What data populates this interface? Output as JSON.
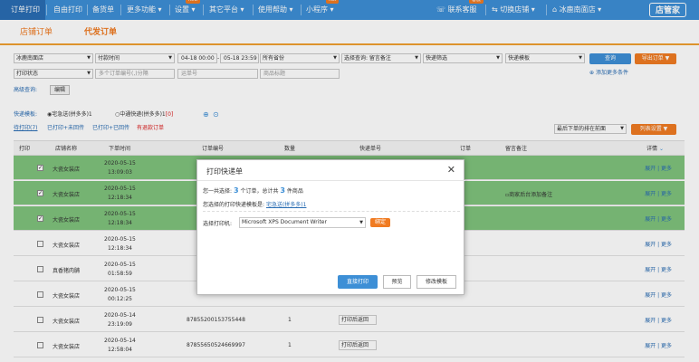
{
  "nav": {
    "items": [
      "订单打印",
      "自由打印",
      "备货单",
      "更多功能",
      "设置",
      "其它平台",
      "使用帮助",
      "小程序"
    ],
    "settings_badge": "new",
    "miniapp_badge": "hot",
    "right_items": [
      "联系客服",
      "切换店铺",
      "冰鹿南面店"
    ],
    "right_badge": "客服",
    "brand": "店管家"
  },
  "subtabs": [
    "店铺订单",
    "代发订单"
  ],
  "filters": {
    "row1": {
      "store": "冰鹿南面店",
      "time_type": "付款时间",
      "date_start": "04-18 00:00",
      "date_end": "05-18 23:59",
      "province": "所有省份",
      "note_query": "选择查询: 留言备注",
      "express_filter": "快递筛选",
      "express_template": "快递模板",
      "query_btn": "查询",
      "export_btn": "导出订单 ▼"
    },
    "row2": {
      "print_status": "打印状态",
      "order_no_placeholder": "多个订单编号(,)分隔",
      "waybill_placeholder": "运单号",
      "product_placeholder": "商品标题",
      "add_condition": "添加更多条件"
    },
    "row3": {
      "label": "高级查询:",
      "edit_btn": "编辑"
    }
  },
  "express": {
    "label": "快递模板:",
    "opt1": "宅急送(拼多多)1",
    "opt2": "中通快递(拼多多)1",
    "opt2_count": "[0]",
    "add_icon": "plus-circle-icon",
    "settings_icon": "gear-circle-icon"
  },
  "status_links": {
    "l1": "待打印",
    "l1_count": "(7)",
    "l2": "已打印+未回传",
    "l3": "已打印+已回传",
    "l4": "有退款订单",
    "sort": "最后下单的排在前面",
    "list_settings": "列表设置 ▼"
  },
  "table": {
    "headers": [
      "打印",
      "店铺名称",
      "下单时间",
      "订单编号",
      "数量",
      "快递单号",
      "订单",
      "留言备注",
      "详情"
    ],
    "rows": [
      {
        "checked": true,
        "hl": true,
        "store": "大瓷女装店",
        "date": "2020-05-15",
        "time": "13:09:03",
        "order": "",
        "qty": "",
        "ship": "",
        "remark": "",
        "actions": "展开 | 更多"
      },
      {
        "checked": true,
        "hl": true,
        "store": "大瓷女装店",
        "date": "2020-05-15",
        "time": "12:18:34",
        "order": "",
        "qty": "",
        "ship": "",
        "remark": "商家后台添加备注",
        "actions": "展开 | 更多"
      },
      {
        "checked": true,
        "hl": true,
        "store": "大瓷女装店",
        "date": "2020-05-15",
        "time": "12:18:34",
        "order": "",
        "qty": "",
        "ship": "",
        "remark": "",
        "actions": "展开 | 更多"
      },
      {
        "checked": false,
        "hl": false,
        "store": "大瓷女装店",
        "date": "2020-05-15",
        "time": "12:18:34",
        "order": "",
        "qty": "",
        "ship": "",
        "remark": "",
        "actions": "展开 | 更多"
      },
      {
        "checked": false,
        "hl": false,
        "store": "真香猪肉脯",
        "date": "2020-05-15",
        "time": "01:58:59",
        "order": "",
        "qty": "",
        "ship": "",
        "remark": "",
        "actions": "展开 | 更多"
      },
      {
        "checked": false,
        "hl": false,
        "store": "大瓷女装店",
        "date": "2020-05-15",
        "time": "00:12:25",
        "order": "",
        "qty": "",
        "ship": "",
        "remark": "",
        "actions": "展开 | 更多"
      },
      {
        "checked": false,
        "hl": false,
        "store": "大瓷女装店",
        "date": "2020-05-14",
        "time": "23:19:09",
        "order": "87855200153755448",
        "qty": "1",
        "ship": "打印后返回",
        "remark": "",
        "actions": "展开 | 更多"
      },
      {
        "checked": false,
        "hl": false,
        "store": "大瓷女装店",
        "date": "2020-05-14",
        "time": "12:58:04",
        "order": "87855650524669997",
        "qty": "1",
        "ship": "打印后返回",
        "remark": "",
        "actions": "展开 | 更多"
      }
    ]
  },
  "modal": {
    "title": "打印快递单",
    "close_icon": "close-icon",
    "line1_a": "您一共选择:",
    "line1_n1": "3",
    "line1_b": "个订单，总计共",
    "line1_n2": "3",
    "line1_c": "件商品",
    "line2_a": "您选择的打印快递模板是:",
    "line2_link": "宅急送(拼多多)1",
    "printer_label": "选择打印机:",
    "printer_value": "Microsoft XPS Document Writer",
    "bind_btn": "绑定",
    "buttons": [
      "直接打印",
      "预览",
      "修改模板"
    ]
  }
}
